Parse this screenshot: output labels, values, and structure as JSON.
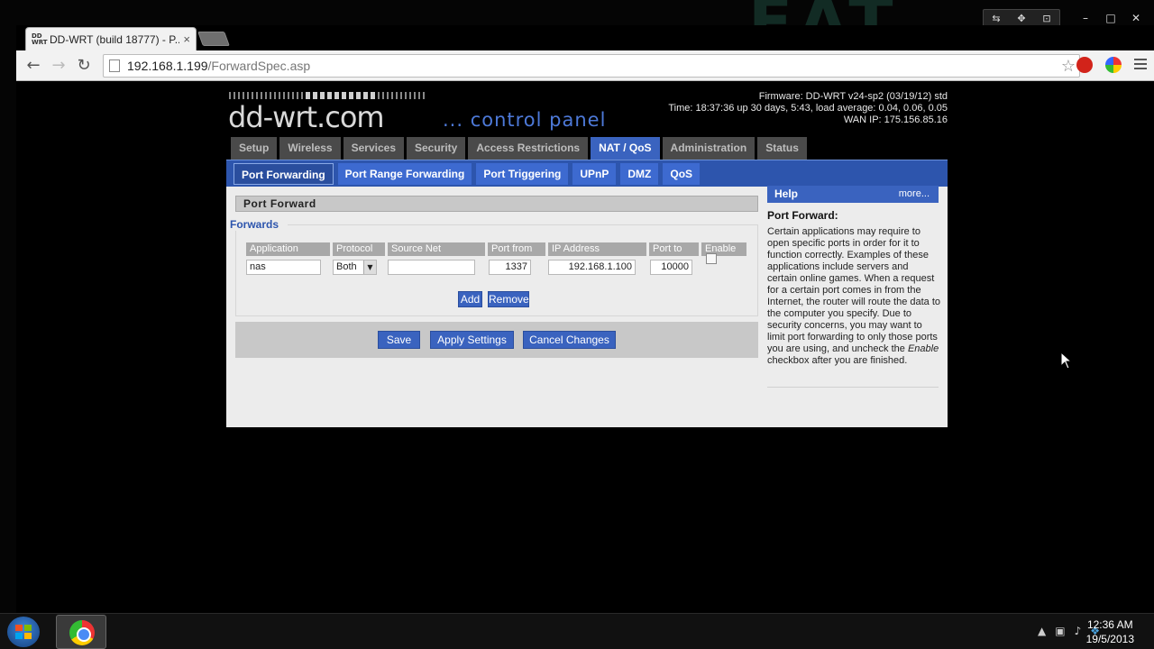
{
  "browser": {
    "tab_title": "DD-WRT (build 18777) - P...",
    "tab_close": "×",
    "url_host": "192.168.1.199",
    "url_path": "/ForwardSpec.asp"
  },
  "header": {
    "logo": "dd-wrt.com",
    "tagline": "... control panel",
    "firmware": "Firmware: DD-WRT v24-sp2 (03/19/12) std",
    "time": "Time: 18:37:36 up 30 days, 5:43, load average: 0.04, 0.06, 0.05",
    "wan_ip": "WAN IP: 175.156.85.16"
  },
  "main_tabs": [
    "Setup",
    "Wireless",
    "Services",
    "Security",
    "Access Restrictions",
    "NAT / QoS",
    "Administration",
    "Status"
  ],
  "sub_tabs": [
    "Port Forwarding",
    "Port Range Forwarding",
    "Port Triggering",
    "UPnP",
    "DMZ",
    "QoS"
  ],
  "port_forward": {
    "title": "Port Forward",
    "legend": "Forwards",
    "columns": [
      "Application",
      "Protocol",
      "Source Net",
      "Port from",
      "IP Address",
      "Port to",
      "Enable"
    ],
    "row": {
      "application": "nas",
      "protocol": "Both",
      "source_net": "",
      "port_from": "1337",
      "ip_address": "192.168.1.100",
      "port_to": "10000",
      "enabled": false
    },
    "add_label": "Add",
    "remove_label": "Remove"
  },
  "actions": {
    "save": "Save",
    "apply": "Apply Settings",
    "cancel": "Cancel Changes"
  },
  "help": {
    "head": "Help",
    "more": "more...",
    "title": "Port Forward:",
    "body_1": "Certain applications may require to open specific ports in order for it to function correctly. Examples of these applications include servers and certain online games. When a request for a certain port comes in from the Internet, the router will route the data to the computer you specify. Due to security concerns, you may want to limit port forwarding to only those ports you are using, and uncheck the ",
    "body_em": "Enable",
    "body_2": " checkbox after you are finished."
  },
  "taskbar": {
    "time": "12:36 AM",
    "date": "19/5/2013"
  }
}
